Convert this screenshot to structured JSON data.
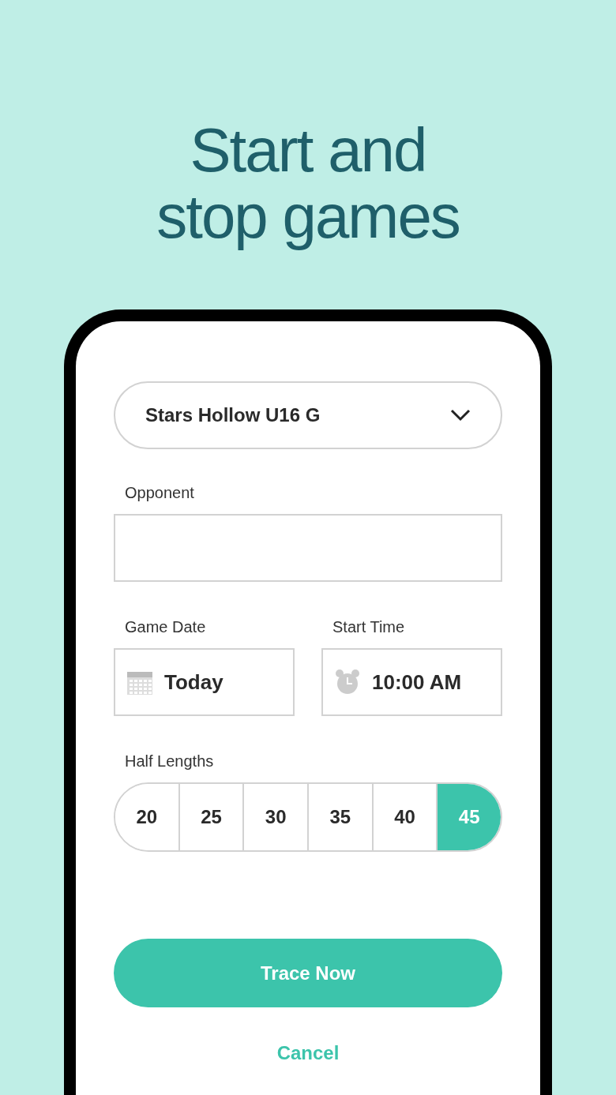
{
  "headline": [
    "Start and",
    "stop games"
  ],
  "team_select": {
    "value": "Stars Hollow U16 G"
  },
  "opponent": {
    "label": "Opponent"
  },
  "game_date": {
    "label": "Game Date",
    "value": "Today"
  },
  "start_time": {
    "label": "Start Time",
    "value": "10:00 AM"
  },
  "half_lengths": {
    "label": "Half Lengths",
    "options": [
      {
        "label": "20",
        "selected": false
      },
      {
        "label": "25",
        "selected": false
      },
      {
        "label": "30",
        "selected": false
      },
      {
        "label": "35",
        "selected": false
      },
      {
        "label": "40",
        "selected": false
      },
      {
        "label": "45",
        "selected": true
      }
    ]
  },
  "primary_button": "Trace Now",
  "cancel_link": "Cancel"
}
